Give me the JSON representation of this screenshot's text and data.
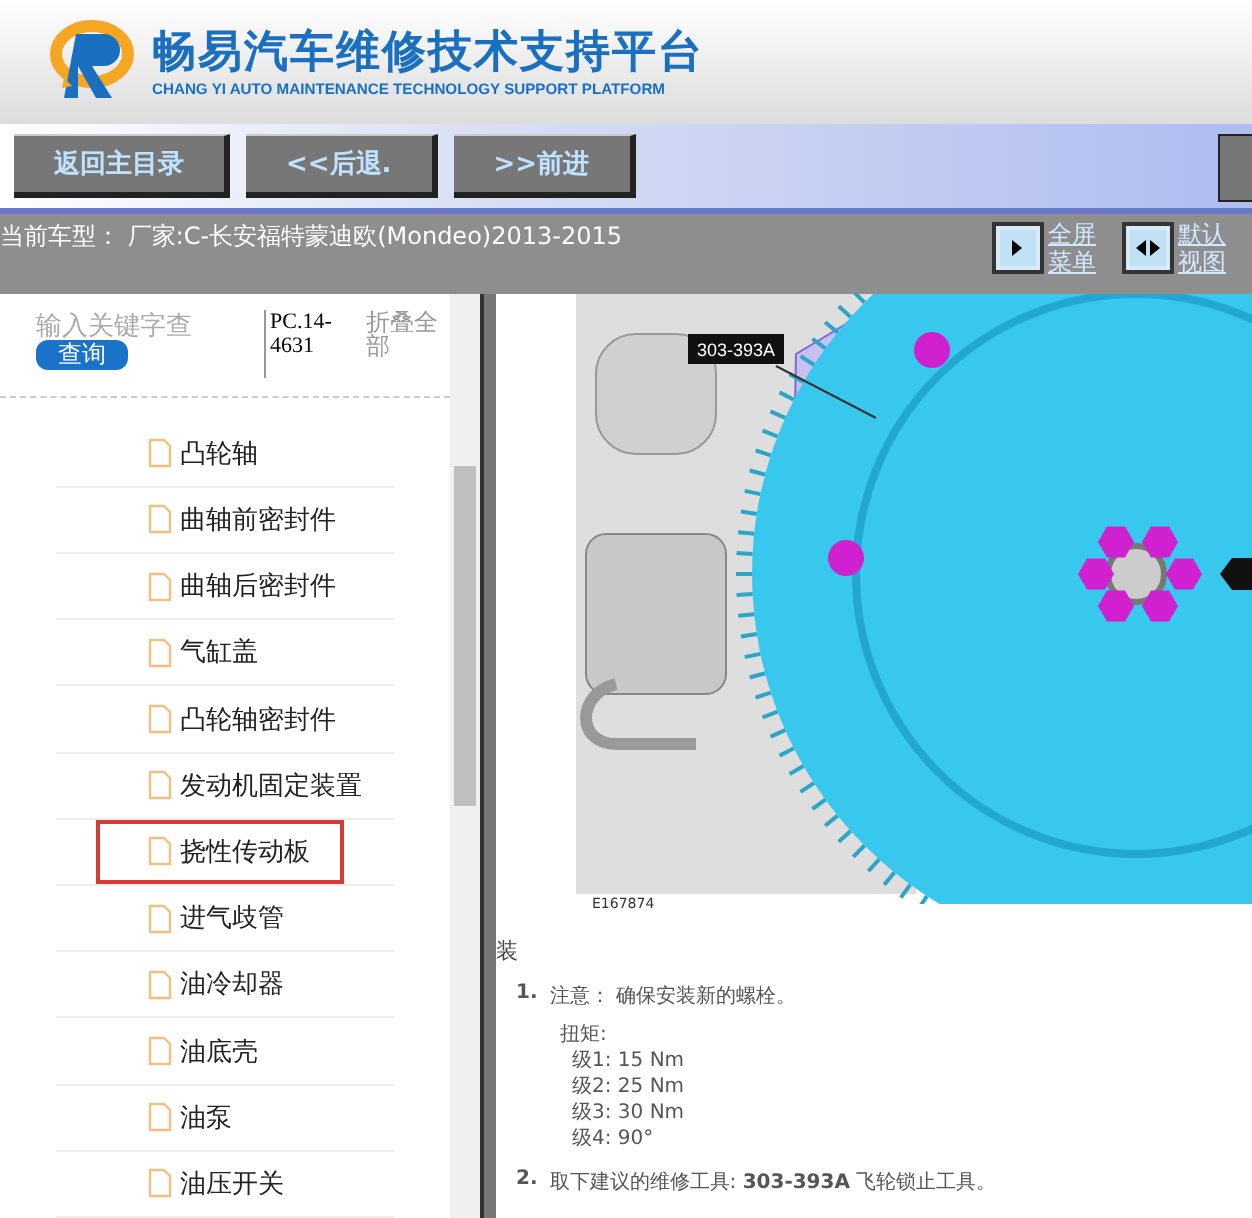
{
  "header": {
    "title": "畅易汽车维修技术支持平台",
    "subtitle": "CHANG YI AUTO MAINTENANCE TECHNOLOGY SUPPORT PLATFORM"
  },
  "toolbar": {
    "buttons": [
      "返回主目录",
      "<<后退.",
      ">>前进"
    ]
  },
  "vehicle": {
    "label": "当前车型：",
    "value": "厂家:C-长安福特蒙迪欧(Mondeo)2013-2015"
  },
  "view_buttons": [
    {
      "kind": "fullscreen",
      "label": "全屏菜单"
    },
    {
      "kind": "default",
      "label": "默认视图"
    }
  ],
  "sidebar": {
    "search_placeholder": "输入关键字查",
    "search_button": "查询",
    "code": "PC.14-4631",
    "collapse": "折叠全部",
    "items": [
      {
        "label": "凸轮轴",
        "selected": false
      },
      {
        "label": "曲轴前密封件",
        "selected": false
      },
      {
        "label": "曲轴后密封件",
        "selected": false
      },
      {
        "label": "气缸盖",
        "selected": false
      },
      {
        "label": "凸轮轴密封件",
        "selected": false
      },
      {
        "label": "发动机固定装置",
        "selected": false
      },
      {
        "label": "挠性传动板",
        "selected": true
      },
      {
        "label": "进气歧管",
        "selected": false
      },
      {
        "label": "油冷却器",
        "selected": false
      },
      {
        "label": "油底壳",
        "selected": false
      },
      {
        "label": "油泵",
        "selected": false
      },
      {
        "label": "油压开关",
        "selected": false
      }
    ]
  },
  "document": {
    "tool_label": "303-393A",
    "figure_id": "E167874",
    "section": "装",
    "steps": [
      {
        "number": "1.",
        "text": "注意： 确保安装新的螺栓。",
        "torque_label": "扭矩:",
        "levels": [
          "级1: 15 Nm",
          "级2: 25 Nm",
          "级3: 30 Nm",
          "级4: 90°"
        ]
      },
      {
        "number": "2.",
        "text": "取下建议的维修工具: **303-393A** 飞轮锁止工具。"
      }
    ]
  }
}
